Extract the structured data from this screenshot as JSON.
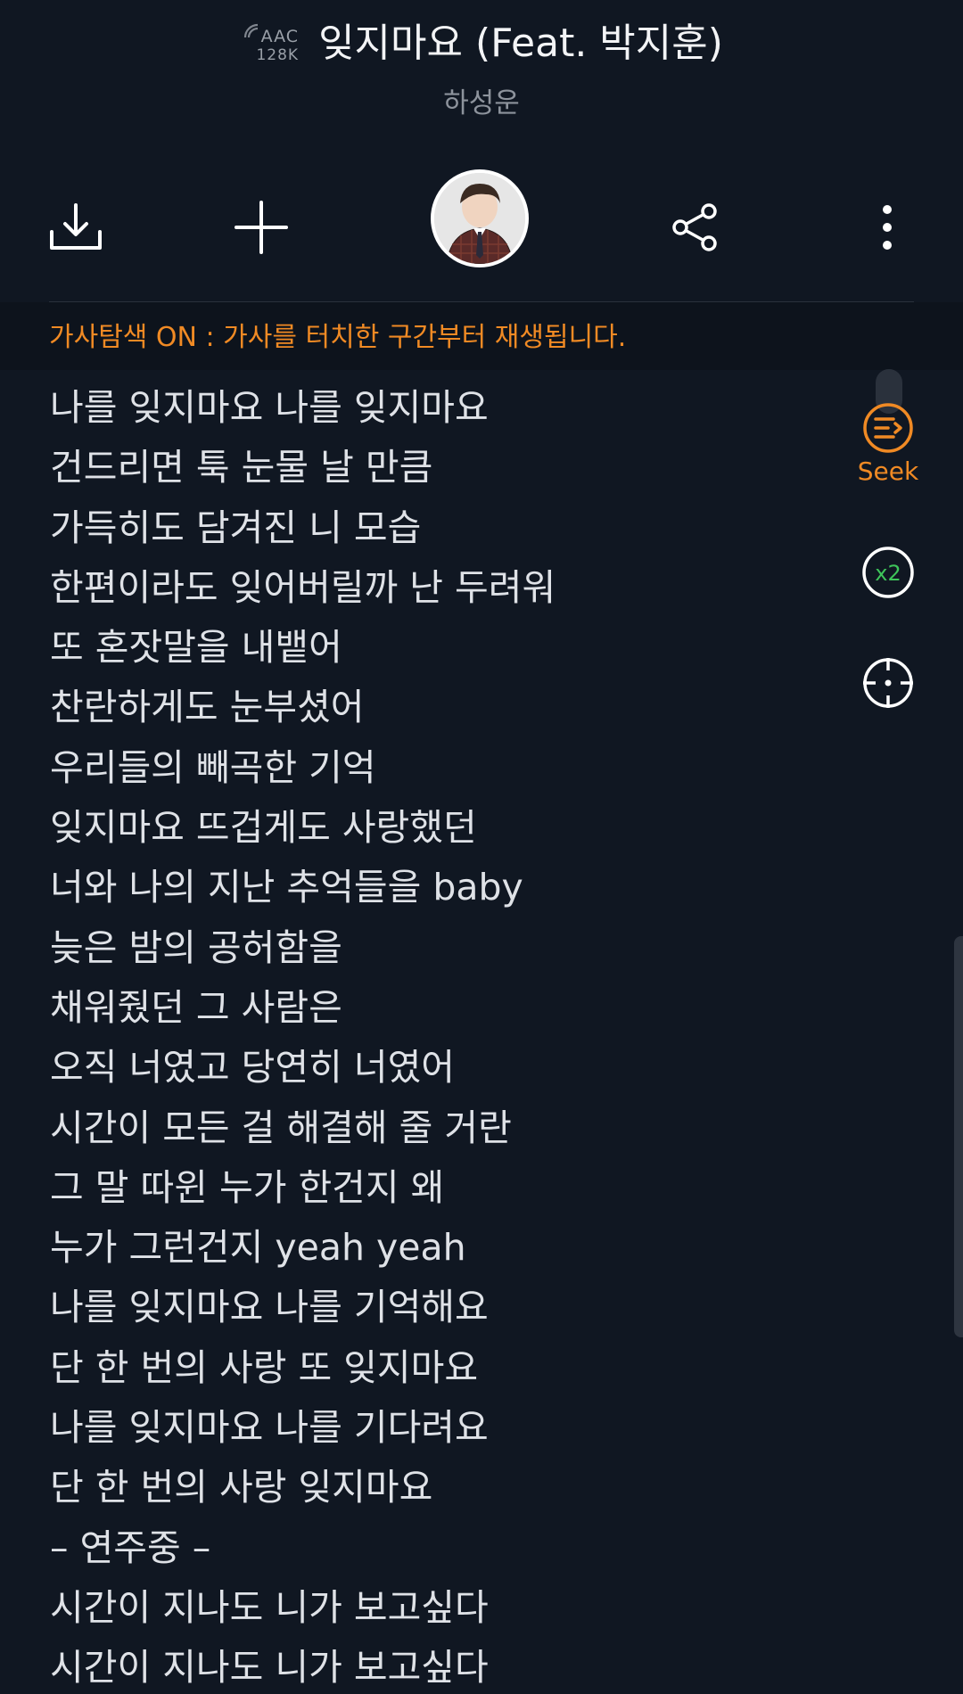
{
  "header": {
    "quality_codec": "AAC",
    "quality_bitrate": "128K",
    "song_title": "잊지마요 (Feat. 박지훈)",
    "artist": "하성운"
  },
  "actions": {
    "download_icon": "download-icon",
    "add_icon": "plus-icon",
    "avatar_icon": "artist-avatar",
    "share_icon": "share-icon",
    "more_icon": "more-vertical-icon"
  },
  "banner": {
    "text": "가사탐색 ON : 가사를 터치한 구간부터 재생됩니다."
  },
  "lyrics": [
    "나를 잊지마요 나를 잊지마요",
    "건드리면 툭 눈물 날 만큼",
    "가득히도 담겨진 니 모습",
    "한편이라도 잊어버릴까 난 두려워",
    "또 혼잣말을 내뱉어",
    "찬란하게도 눈부셨어",
    "우리들의 빼곡한 기억",
    "잊지마요 뜨겁게도 사랑했던",
    "너와 나의 지난 추억들을 baby",
    "늦은 밤의 공허함을",
    "채워줬던 그 사람은",
    "오직 너였고 당연히 너였어",
    "시간이 모든 걸 해결해 줄 거란",
    "그 말 따윈 누가 한건지 왜",
    "누가 그런건지 yeah yeah",
    "나를 잊지마요 나를 기억해요",
    "단 한 번의 사랑 또 잊지마요",
    "나를 잊지마요 나를 기다려요",
    "단 한 번의 사랑 잊지마요",
    "– 연주중 –",
    "시간이 지나도 니가 보고싶다",
    "시간이 지나도 니가 보고싶다"
  ],
  "controls": {
    "seek_label": "Seek",
    "speed_label": "x2"
  },
  "colors": {
    "background": "#101722",
    "accent_orange": "#f08a24",
    "accent_green": "#3ec45a"
  }
}
